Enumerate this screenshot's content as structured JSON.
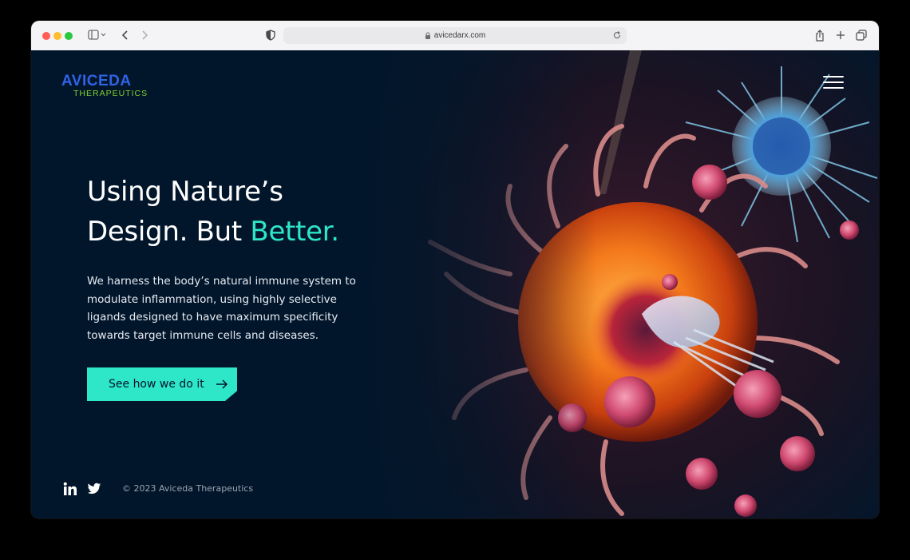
{
  "browser": {
    "url": "avicedarx.com"
  },
  "logo": {
    "name": "AVICEDA",
    "tagline": "THERAPEUTICS"
  },
  "hero": {
    "headline_line1": "Using Nature’s",
    "headline_line2_start": "Design. But ",
    "headline_accent": "Better.",
    "lead": "We harness the body’s natural immune system to modulate inflammation, using highly selective ligands designed to have maximum specificity towards target immune cells and diseases.",
    "cta_label": "See how we do it"
  },
  "footer": {
    "copyright": "© 2023 Aviceda Therapeutics"
  },
  "icons": [
    "sidebar-icon",
    "chevron-left-icon",
    "chevron-right-icon",
    "shield-icon",
    "lock-icon",
    "reload-icon",
    "share-icon",
    "plus-icon",
    "tabs-icon",
    "menu-icon",
    "arrow-right-icon",
    "linkedin-icon",
    "twitter-icon"
  ],
  "colors": {
    "background": "#02162b",
    "accent": "#2ee6c8",
    "logo_blue": "#2f63e6",
    "logo_green": "#7fd12d"
  }
}
